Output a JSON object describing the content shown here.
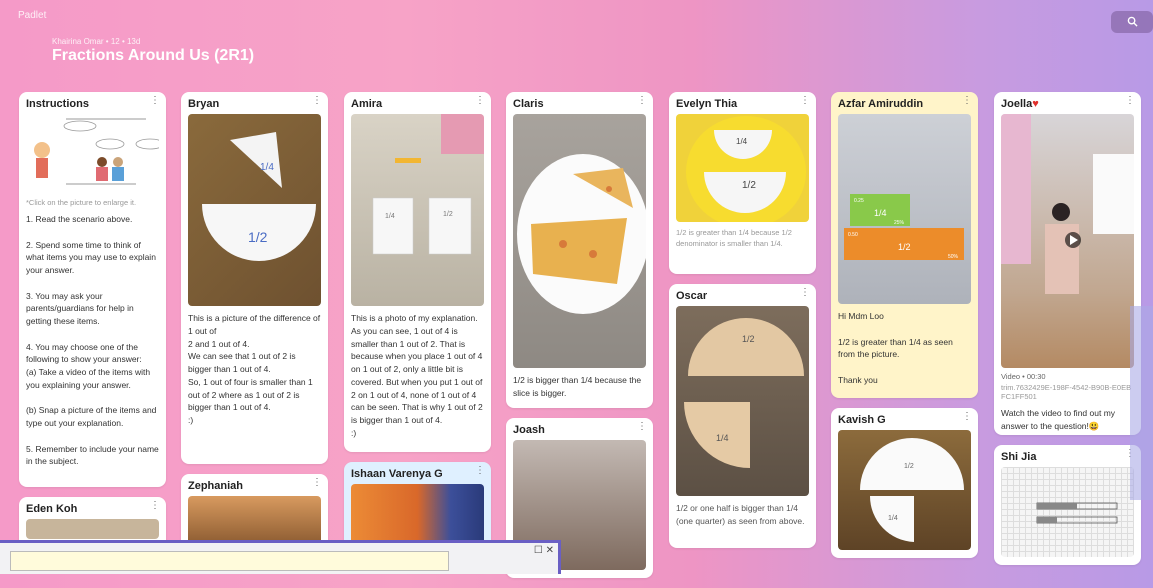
{
  "app": {
    "brand": "Padlet"
  },
  "header": {
    "meta": "Khairina Omar • 12 • 13d",
    "title": "Fractions Around Us (2R1)",
    "search_icon": "search-icon"
  },
  "columns": [
    {
      "cards": [
        {
          "title": "Instructions",
          "hint": "*Click on the picture to enlarge it.",
          "body": "1. Read the scenario above.\n\n2. Spend some time to think of what items you may use to explain your answer.\n\n3. You may ask your parents/guardians for help in getting these items.\n\n4. You may choose one of the following to show your answer:\n (a) Take a video of the items with you explaining your answer.\n\n (b) Snap a picture of the items and type out your explanation.\n\n5. Remember to include your name in the subject."
        },
        {
          "title": "Eden Koh"
        }
      ]
    },
    {
      "cards": [
        {
          "title": "Bryan",
          "body": "This is a picture of the difference of 1 out of\n2 and 1 out of 4.\nWe can see that 1 out of 2 is bigger than 1 out of 4.\nSo, 1 out of four is smaller than 1 out of 2 where as 1 out of 2 is bigger than 1 out of 4.\n:)"
        },
        {
          "title": "Zephaniah"
        }
      ]
    },
    {
      "cards": [
        {
          "title": "Amira",
          "body": "This is a photo of my explanation. As you can see, 1 out of 4 is smaller than 1 out of 2. That is because when you place 1 out of 4 on 1 out of 2, only a little bit is covered. But when you put 1 out of 2 on 1 out of 4, none of 1 out of 4 can be seen. That is why 1 out of 2 is bigger than 1 out of 4.\n:)"
        },
        {
          "title": "Ishaan Varenya G"
        }
      ]
    },
    {
      "cards": [
        {
          "title": "Claris",
          "body": "1/2 is bigger than 1/4 because the slice is bigger."
        },
        {
          "title": "Joash"
        }
      ]
    },
    {
      "cards": [
        {
          "title": "Evelyn Thia",
          "body": "1/2 is greater than 1/4 because 1/2 denominator is smaller than 1/4."
        },
        {
          "title": "Oscar",
          "body": "1/2 or one half is bigger than 1/4 (one quarter) as seen from above."
        }
      ]
    },
    {
      "cards": [
        {
          "title": "Azfar Amiruddin",
          "body": "Hi Mdm Loo\n\n1/2 is greater than 1/4 as seen from the picture.\n\nThank you"
        },
        {
          "title": "Kavish G"
        }
      ]
    },
    {
      "cards": [
        {
          "title": "Joella",
          "video": "Video • 00:30",
          "file": "trim.7632429E-198F-4542-B90B-E0EBFC1FF501",
          "body": "Watch the video to find out my answer to the question!😃"
        },
        {
          "title": "Shi Jia"
        }
      ]
    }
  ],
  "photo_labels": {
    "half": "1/2",
    "quarter": "1/4",
    "green_pct": "25%",
    "green_val": "0.25",
    "orange_pct": "50%",
    "orange_val": "0.50"
  },
  "popup": {
    "btns": "☐ ✕"
  },
  "colors": {
    "accent": "#6a5fc4",
    "yellow_card": "#fff4c9",
    "blue_card": "#dff0ff"
  }
}
